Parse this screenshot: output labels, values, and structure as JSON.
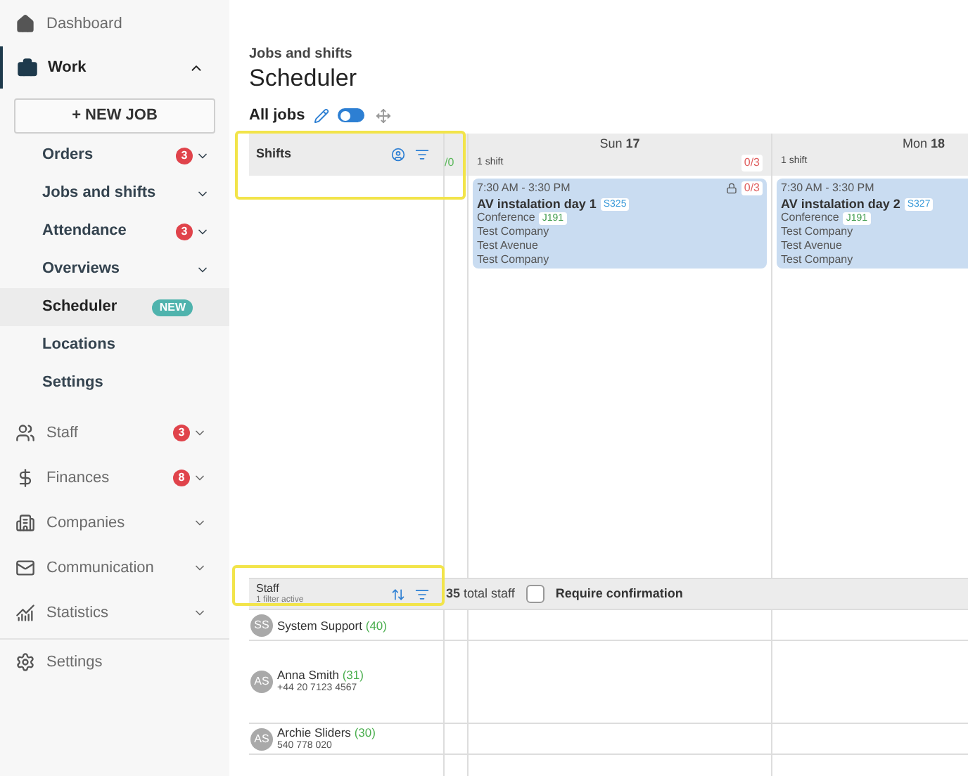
{
  "sidebar": {
    "dashboard": {
      "label": "Dashboard"
    },
    "work": {
      "label": "Work",
      "expanded": true,
      "new_job_button": "+ NEW JOB",
      "items": [
        {
          "label": "Orders",
          "badge": "3",
          "selected": false,
          "has_caret": true
        },
        {
          "label": "Jobs and shifts",
          "selected": false,
          "has_caret": true
        },
        {
          "label": "Attendance",
          "badge": "3",
          "selected": false,
          "has_caret": true
        },
        {
          "label": "Overviews",
          "selected": false,
          "has_caret": true
        },
        {
          "label": "Scheduler",
          "tag": "NEW",
          "selected": true,
          "has_caret": false
        },
        {
          "label": "Locations",
          "selected": false,
          "has_caret": false
        },
        {
          "label": "Settings",
          "selected": false,
          "has_caret": false
        }
      ]
    },
    "sections": [
      {
        "label": "Staff",
        "badge": "3",
        "expanded": false
      },
      {
        "label": "Finances",
        "badge": "8",
        "expanded": false
      },
      {
        "label": "Companies",
        "expanded": false
      },
      {
        "label": "Communication",
        "expanded": false
      },
      {
        "label": "Statistics",
        "expanded": false
      }
    ],
    "settings": {
      "label": "Settings"
    }
  },
  "header": {
    "breadcrumb": "Jobs and shifts",
    "title": "Scheduler"
  },
  "toolbar": {
    "label": "All jobs",
    "toggle_on": false
  },
  "shifts_panel": {
    "title": "Shifts",
    "partial_count": "/0",
    "days": [
      {
        "weekday": "Sun",
        "day": "17",
        "shift_count": "1 shift",
        "ratio": "0/3",
        "shifts": [
          {
            "time": "7:30 AM - 3:30 PM",
            "locked": true,
            "ratio": "0/3",
            "title": "AV instalation day 1",
            "code": "S325",
            "type": "Conference",
            "job_code": "J191",
            "lines": [
              "Test Company",
              "Test Avenue",
              "Test Company"
            ]
          }
        ]
      },
      {
        "weekday": "Mon",
        "day": "18",
        "shift_count": "1 shift",
        "shifts": [
          {
            "time": "7:30 AM - 3:30 PM",
            "title": "AV instalation day 2",
            "code": "S327",
            "type": "Conference",
            "job_code": "J191",
            "lines": [
              "Test Company",
              "Test Avenue",
              "Test Company"
            ]
          }
        ]
      }
    ]
  },
  "staff_panel": {
    "title": "Staff",
    "subtitle": "1 filter active",
    "total": "**35** total staff",
    "require_confirmation": {
      "label": "Require confirmation",
      "checked": false
    },
    "members": [
      {
        "initials": "SS",
        "name": "System Support",
        "count": "(40)"
      },
      {
        "initials": "AS",
        "name": "Anna Smith",
        "count": "(31)",
        "phone": "+44 20 7123 4567"
      },
      {
        "initials": "AS",
        "name": "Archie Sliders",
        "count": "(30)",
        "phone": "540 778 020"
      }
    ]
  }
}
